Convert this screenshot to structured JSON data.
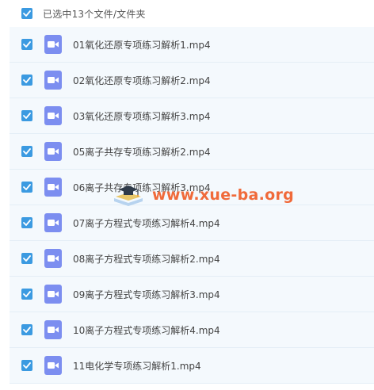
{
  "header": {
    "selection_label": "已选中13个文件/文件夹",
    "checked": true
  },
  "icons": {
    "checkbox": "checkmark-icon",
    "file": "video-file-icon"
  },
  "colors": {
    "checkbox_accent": "#3b9ae1",
    "row_background": "#f4f9fd",
    "video_icon": "#7c8ef0",
    "watermark": "#f06a3a"
  },
  "files": [
    {
      "name": "01氧化还原专项练习解析1.mp4",
      "checked": true
    },
    {
      "name": "02氧化还原专项练习解析2.mp4",
      "checked": true
    },
    {
      "name": "03氧化还原专项练习解析3.mp4",
      "checked": true
    },
    {
      "name": "05离子共存专项练习解析2.mp4",
      "checked": true
    },
    {
      "name": "06离子共存专项练习解析3.mp4",
      "checked": true
    },
    {
      "name": "07离子方程式专项练习解析4.mp4",
      "checked": true
    },
    {
      "name": "08离子方程式专项练习解析2.mp4",
      "checked": true
    },
    {
      "name": "09离子方程式专项练习解析3.mp4",
      "checked": true
    },
    {
      "name": "10离子方程式专项练习解析4.mp4",
      "checked": true
    },
    {
      "name": "11电化学专项练习解析1.mp4",
      "checked": true
    }
  ],
  "watermark": {
    "text": "www.xue-ba.org"
  }
}
